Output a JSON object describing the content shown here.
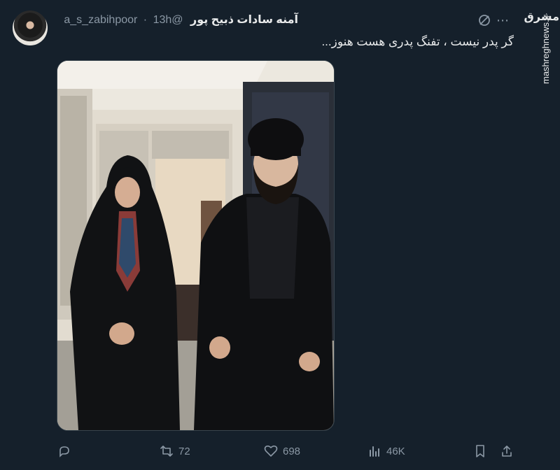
{
  "tweet": {
    "display_name": "آمنه سادات ذبیح پور",
    "handle": "@a_s_zabihpoor",
    "separator": "·",
    "time": "13h",
    "text": "گر پدر نیست ، تفنگ پدری هست هنوز...",
    "avatar_icon": "avatar",
    "media_alt": "photo"
  },
  "actions": {
    "reply_count": "",
    "retweet_count": "72",
    "like_count": "698",
    "views_count": "46K"
  },
  "watermark": {
    "logo": "مشرق",
    "url": "mashreghnews.ir"
  },
  "colors": {
    "background": "#15202b",
    "text": "#e7e9ea",
    "muted": "#8b98a5"
  }
}
